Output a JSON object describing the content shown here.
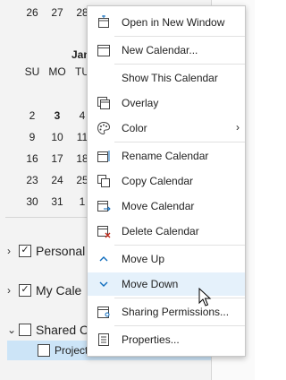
{
  "calendar": {
    "top_row": [
      "26",
      "27",
      "28"
    ],
    "month_label": "Jan",
    "weekday_headers": [
      "SU",
      "MO",
      "TU"
    ],
    "weeks": [
      [
        "2",
        "3",
        "4"
      ],
      [
        "9",
        "10",
        "11"
      ],
      [
        "16",
        "17",
        "18"
      ],
      [
        "23",
        "24",
        "25"
      ],
      [
        "30",
        "31",
        "1"
      ]
    ]
  },
  "groups": {
    "personal": "Personal",
    "my_calendars": "My Cale",
    "shared": "Shared C",
    "project": "Project"
  },
  "menu": {
    "items": [
      {
        "label": "Open in New Window",
        "icon": "open-window-icon"
      },
      {
        "label": "New Calendar...",
        "icon": "new-calendar-icon"
      },
      {
        "label": "Show This Calendar",
        "icon": ""
      },
      {
        "label": "Overlay",
        "icon": "overlay-icon"
      },
      {
        "label": "Color",
        "icon": "palette-icon"
      },
      {
        "label": "Rename Calendar",
        "icon": "rename-calendar-icon"
      },
      {
        "label": "Copy Calendar",
        "icon": "copy-calendar-icon"
      },
      {
        "label": "Move Calendar",
        "icon": "move-calendar-icon"
      },
      {
        "label": "Delete Calendar",
        "icon": "delete-calendar-icon"
      },
      {
        "label": "Move Up",
        "icon": "chevron-up-icon"
      },
      {
        "label": "Move Down",
        "icon": "chevron-down-icon"
      },
      {
        "label": "Sharing Permissions...",
        "icon": "sharing-permissions-icon"
      },
      {
        "label": "Properties...",
        "icon": "properties-icon"
      }
    ],
    "hovered_item": "Move Down"
  },
  "colors": {
    "accent": "#0f6cbd",
    "hover": "#e5f1fb",
    "selected_row": "#cce4f7",
    "delete_red": "#c42b1c"
  }
}
